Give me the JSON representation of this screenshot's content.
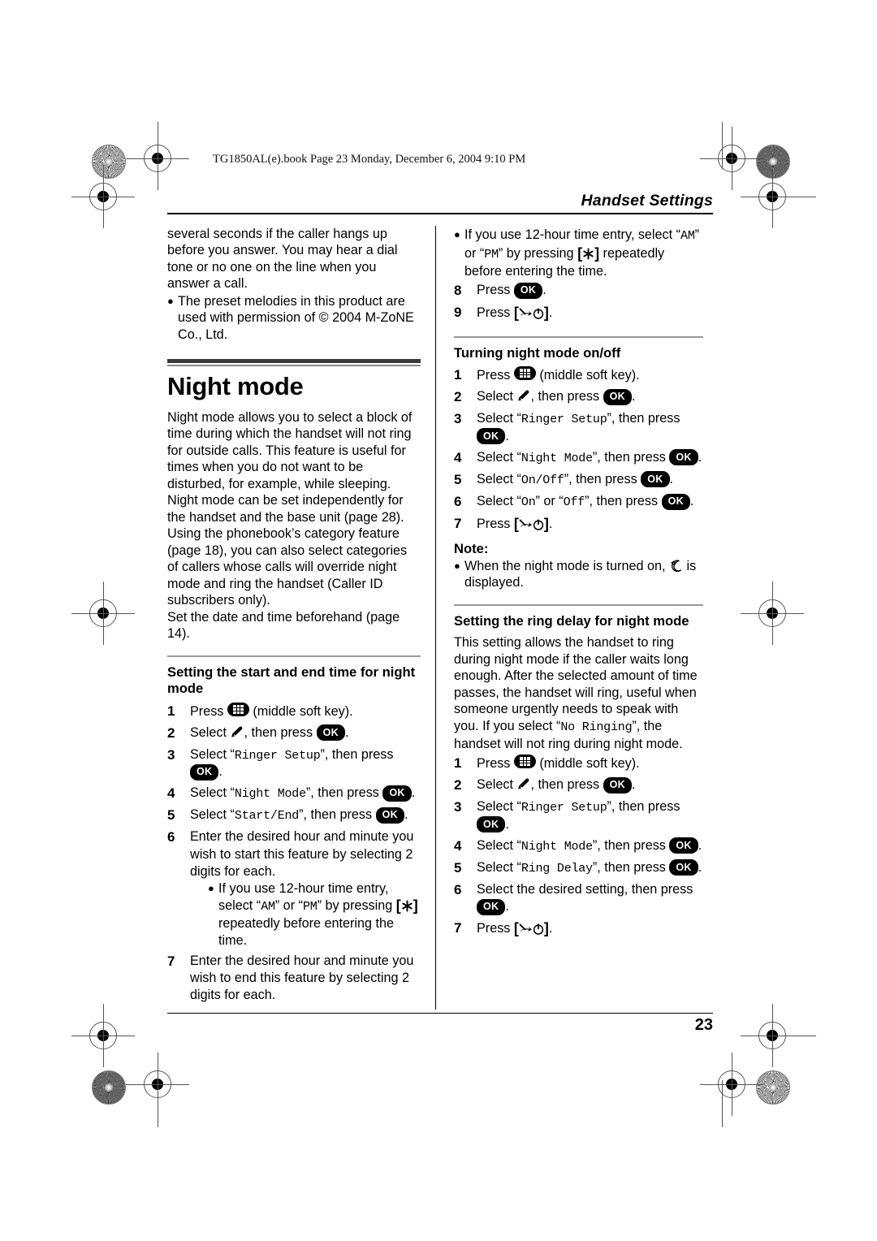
{
  "document": {
    "book_tag": "TG1850AL(e).book  Page 23  Monday, December 6, 2004  9:10 PM",
    "running_head": "Handset Settings",
    "page_number": "23"
  },
  "icons": {
    "ok_label": "OK",
    "soft_key": "middle-soft-key-icon",
    "wrench": "ringer-setup-icon",
    "star_key": "star-key-icon",
    "offhook": "off-hook-power-key-icon",
    "moon": "night-mode-moon-icon"
  },
  "left_column": {
    "continued_paragraph": "several seconds if the caller hangs up before you answer. You may hear a dial tone or no one on the line when you answer a call.",
    "melody_bullet": "The preset melodies in this product are used with permission of © 2004 M-ZoNE Co., Ltd.",
    "feature_title": "Night mode",
    "intro_paragraph_1": "Night mode allows you to select a block of time during which the handset will not ring for outside calls. This feature is useful for times when you do not want to be disturbed, for example, while sleeping. Night mode can be set independently for the handset and the base unit (page 28).",
    "intro_paragraph_2": "Using the phonebook’s category feature (page 18), you can also select categories of callers whose calls will override night mode and ring the handset (Caller ID subscribers only).",
    "intro_paragraph_3": "Set the date and time beforehand (page 14).",
    "section_title": "Setting the start and end time for night mode",
    "steps": [
      {
        "num": "1",
        "pre": "Press ",
        "post": " (middle soft key).",
        "icon": "soft-key"
      },
      {
        "num": "2",
        "pre": "Select ",
        "mid": ", then press ",
        "post": ".",
        "icon": "wrench-ok"
      },
      {
        "num": "3",
        "pre": "Select “",
        "mono": "Ringer Setup",
        "mid": "”, then press ",
        "post": ".",
        "icon": "ok"
      },
      {
        "num": "4",
        "pre": "Select “",
        "mono": "Night Mode",
        "mid": "”, then press ",
        "post": ".",
        "icon": "ok"
      },
      {
        "num": "5",
        "pre": "Select “",
        "mono": "Start/End",
        "mid": "”, then press ",
        "post": ".",
        "icon": "ok"
      },
      {
        "num": "6",
        "text": "Enter the desired hour and minute you wish to start this feature by selecting 2 digits for each."
      },
      {
        "num": "7",
        "text": "Enter the desired hour and minute you wish to end this feature by selecting 2 digits for each."
      }
    ],
    "step6_bullet_pre": "If you use 12-hour time entry, select “",
    "step6_bullet_am": "AM",
    "step6_bullet_mid": "” or “",
    "step6_bullet_pm": "PM",
    "step6_bullet_post": "” by pressing ",
    "step6_bullet_tail": " repeatedly before entering the time."
  },
  "right_column": {
    "top_bullet_pre": "If you use 12-hour time entry, select “",
    "top_bullet_am": "AM",
    "top_bullet_mid": "” or “",
    "top_bullet_pm": "PM",
    "top_bullet_post": "” by pressing ",
    "top_bullet_tail": " repeatedly before entering the time.",
    "step8": {
      "num": "8",
      "pre": "Press ",
      "post": "."
    },
    "step9": {
      "num": "9",
      "pre": "Press ",
      "post": "."
    },
    "onoff_section_title": "Turning night mode on/off",
    "onoff_steps": [
      {
        "num": "1",
        "pre": "Press ",
        "post": " (middle soft key).",
        "icon": "soft-key"
      },
      {
        "num": "2",
        "pre": "Select ",
        "mid": ", then press ",
        "post": ".",
        "icon": "wrench-ok"
      },
      {
        "num": "3",
        "pre": "Select “",
        "mono": "Ringer Setup",
        "mid": "”, then press ",
        "post": ".",
        "icon": "ok"
      },
      {
        "num": "4",
        "pre": "Select “",
        "mono": "Night Mode",
        "mid": "”, then press ",
        "post": ".",
        "icon": "ok"
      },
      {
        "num": "5",
        "pre": "Select “",
        "mono": "On/Off",
        "mid": "”, then press ",
        "post": ".",
        "icon": "ok"
      },
      {
        "num": "6",
        "pre": "Select “",
        "mono": "On",
        "mid": "” or “",
        "mono2": "Off",
        "mid2": "”, then press ",
        "post": ".",
        "icon": "ok"
      },
      {
        "num": "7",
        "pre": "Press ",
        "post": "."
      }
    ],
    "note_title": "Note:",
    "note_pre": "When the night mode is turned on, ",
    "note_post": " is displayed.",
    "ringdelay_section_title": "Setting the ring delay for night mode",
    "ringdelay_paragraph_pre": "This setting allows the handset to ring during night mode if the caller waits long enough. After the selected amount of time passes, the handset will ring, useful when someone urgently needs to speak with you. If you select “",
    "ringdelay_mono": "No Ringing",
    "ringdelay_paragraph_post": "”, the handset will not ring during night mode.",
    "ringdelay_steps": [
      {
        "num": "1",
        "pre": "Press ",
        "post": " (middle soft key).",
        "icon": "soft-key"
      },
      {
        "num": "2",
        "pre": "Select ",
        "mid": ", then press ",
        "post": ".",
        "icon": "wrench-ok"
      },
      {
        "num": "3",
        "pre": "Select “",
        "mono": "Ringer Setup",
        "mid": "”, then press ",
        "post": ".",
        "icon": "ok"
      },
      {
        "num": "4",
        "pre": "Select “",
        "mono": "Night Mode",
        "mid": "”, then press ",
        "post": ".",
        "icon": "ok"
      },
      {
        "num": "5",
        "pre": "Select “",
        "mono": "Ring Delay",
        "mid": "”, then press ",
        "post": ".",
        "icon": "ok"
      },
      {
        "num": "6",
        "pre": "Select the desired setting, then press ",
        "post": ".",
        "icon": "ok"
      },
      {
        "num": "7",
        "pre": "Press ",
        "post": "."
      }
    ]
  }
}
